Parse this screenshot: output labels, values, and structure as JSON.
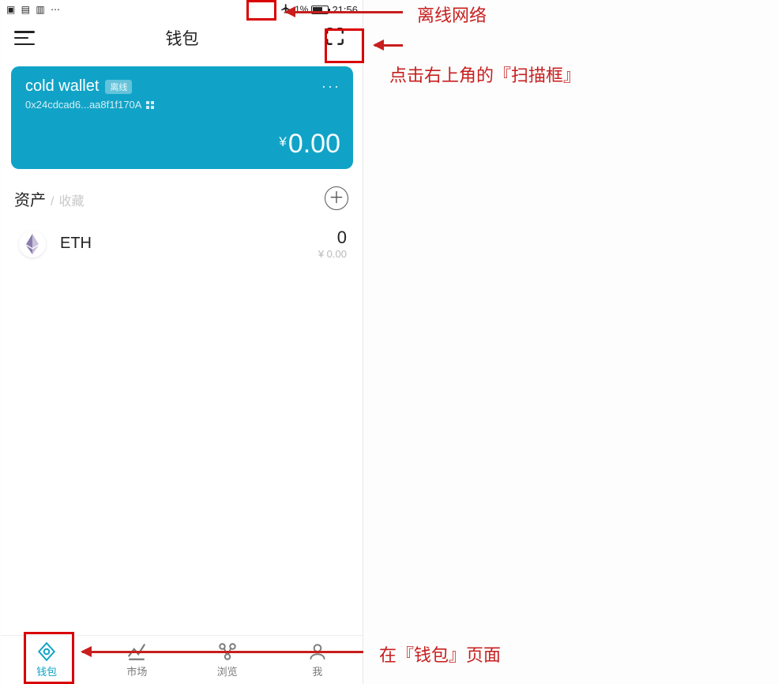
{
  "statusbar": {
    "left_glyphs": "▣ ▤ ▥ ⋯",
    "battery_pct": "1%",
    "clock": "21:56"
  },
  "nav": {
    "title": "钱包"
  },
  "wallet_card": {
    "name": "cold wallet",
    "status_tag": "离线",
    "address": "0x24cdcad6...aa8f1f170A",
    "currency_symbol": "¥",
    "balance": "0.00"
  },
  "assets_header": {
    "tab_assets": "资产",
    "separator": "/",
    "tab_fav": "收藏"
  },
  "assets": [
    {
      "symbol": "ETH",
      "amount": "0",
      "fiat": "¥ 0.00"
    }
  ],
  "tabbar": {
    "wallet": "钱包",
    "market": "市场",
    "browse": "浏览",
    "me": "我"
  },
  "annotations": {
    "offline_network": "离线网络",
    "scan_hint": "点击右上角的『扫描框』",
    "wallet_page": "在『钱包』页面"
  }
}
